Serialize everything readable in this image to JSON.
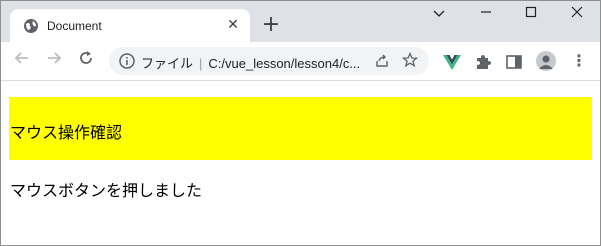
{
  "browser": {
    "tab": {
      "title": "Document",
      "icon": "globe-icon"
    },
    "window_controls": [
      "chevron-down-icon",
      "minimize-icon",
      "maximize-icon",
      "close-icon"
    ],
    "address_bar": {
      "label": "ファイル",
      "url": "C:/vue_lesson/lesson4/c..."
    }
  },
  "page": {
    "yellow_box_text": "マウス操作確認",
    "result_text": "マウスボタンを押しました",
    "yellow_box_color": "#ffff00"
  },
  "colors": {
    "tabstrip": "#dee1e6",
    "vue_green": "#41b883",
    "vue_dark": "#35495e"
  }
}
